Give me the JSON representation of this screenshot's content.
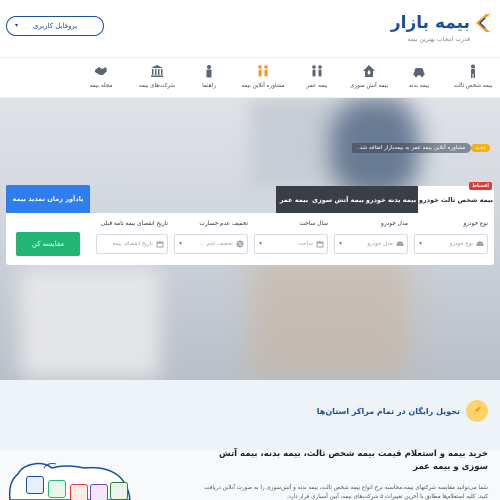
{
  "header": {
    "logo_title": "بیمه بازار",
    "logo_subtitle": "قدرت انتخاب بهترین بیمه",
    "profile_button": "پروفایل کاربری"
  },
  "nav": {
    "items": [
      {
        "label": "بیمه شخص ثالث",
        "icon": "person-icon"
      },
      {
        "label": "بیمه بدنه",
        "icon": "car-icon"
      },
      {
        "label": "بیمه آتش سوزی",
        "icon": "house-fire-icon"
      },
      {
        "label": "بیمه عمر",
        "icon": "family-icon"
      },
      {
        "label": "مشاوره آنلاین بیمه",
        "icon": "consultants-icon"
      },
      {
        "label": "راهنما",
        "icon": "guide-icon"
      },
      {
        "label": "شرکت‌های بیمه",
        "icon": "bank-icon"
      },
      {
        "label": "مجله بیمه",
        "icon": "handshake-icon"
      }
    ]
  },
  "announcement": {
    "tag": "جدید",
    "text": "مشاوره آنلاین بیمه عمر به بیمه‌بازار اضافه شد."
  },
  "tabs": [
    {
      "label": "بیمه شخص ثالث خودرو",
      "active": true,
      "badge": "اقساط"
    },
    {
      "label": "بیمه بدنه خودرو",
      "active": false
    },
    {
      "label": "بیمه آتش سوزی",
      "active": false
    },
    {
      "label": "بیمه عمر",
      "active": false
    }
  ],
  "renew_button": "یادآور زمان تمدید بیمه",
  "form": {
    "fields": [
      {
        "label": "نوع خودرو",
        "placeholder": "نوع خودرو"
      },
      {
        "label": "مدل خودرو",
        "placeholder": "مدل خودرو"
      },
      {
        "label": "سال ساخت",
        "placeholder": "ساخت"
      },
      {
        "label": "تخفیف عدم خسارت",
        "placeholder": "تخفیف عدم ..."
      },
      {
        "label": "تاریخ انقضای بیمه نامه قبلی",
        "placeholder": "تاریخ انقضای بیمه"
      }
    ],
    "compare_button": "مقایسه کن"
  },
  "bottom": {
    "free_delivery": "تحویل رایگان در تمام مراکز استان‌ها",
    "heading": "خرید بیمه و استعلام قیمت بیمه شخص ثالث، بیمه بدنه، بیمه آتش سوزی و بیمه عمر",
    "paragraph": "شما می‌توانید مقایسه شرکتهای بیمه،محاسبه نرخ انواع بیمه شخص ثالث، بیمه بدنه و آتش‌سوزی را به صورت آنلاین دریافت کنید. کلیه استعلام‌ها مطابق با آخرین تغییرات ۵ شرکت‌های بیمه، آیین آسیازی قرار دارد."
  },
  "colors": {
    "brand_blue": "#1b4f9c",
    "accent_blue": "#2f7ef0",
    "green": "#22b573",
    "orange": "#f39a1e",
    "dark_tab": "#3a3f47",
    "yellow": "#f6b400"
  }
}
